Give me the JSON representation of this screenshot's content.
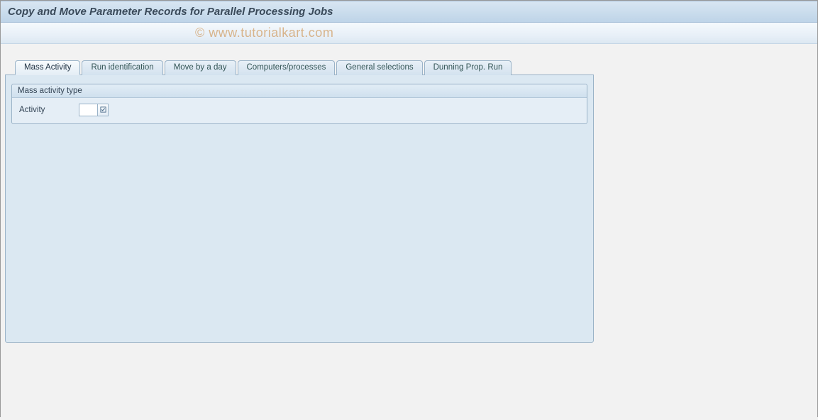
{
  "header": {
    "title": "Copy and Move Parameter Records for Parallel Processing Jobs"
  },
  "watermark": "© www.tutorialkart.com",
  "tabs": [
    {
      "label": "Mass Activity",
      "active": true
    },
    {
      "label": "Run identification",
      "active": false
    },
    {
      "label": "Move by a day",
      "active": false
    },
    {
      "label": "Computers/processes",
      "active": false
    },
    {
      "label": "General selections",
      "active": false
    },
    {
      "label": "Dunning Prop. Run",
      "active": false
    }
  ],
  "panel": {
    "group_title": "Mass activity type",
    "field_label": "Activity",
    "field_value": ""
  }
}
